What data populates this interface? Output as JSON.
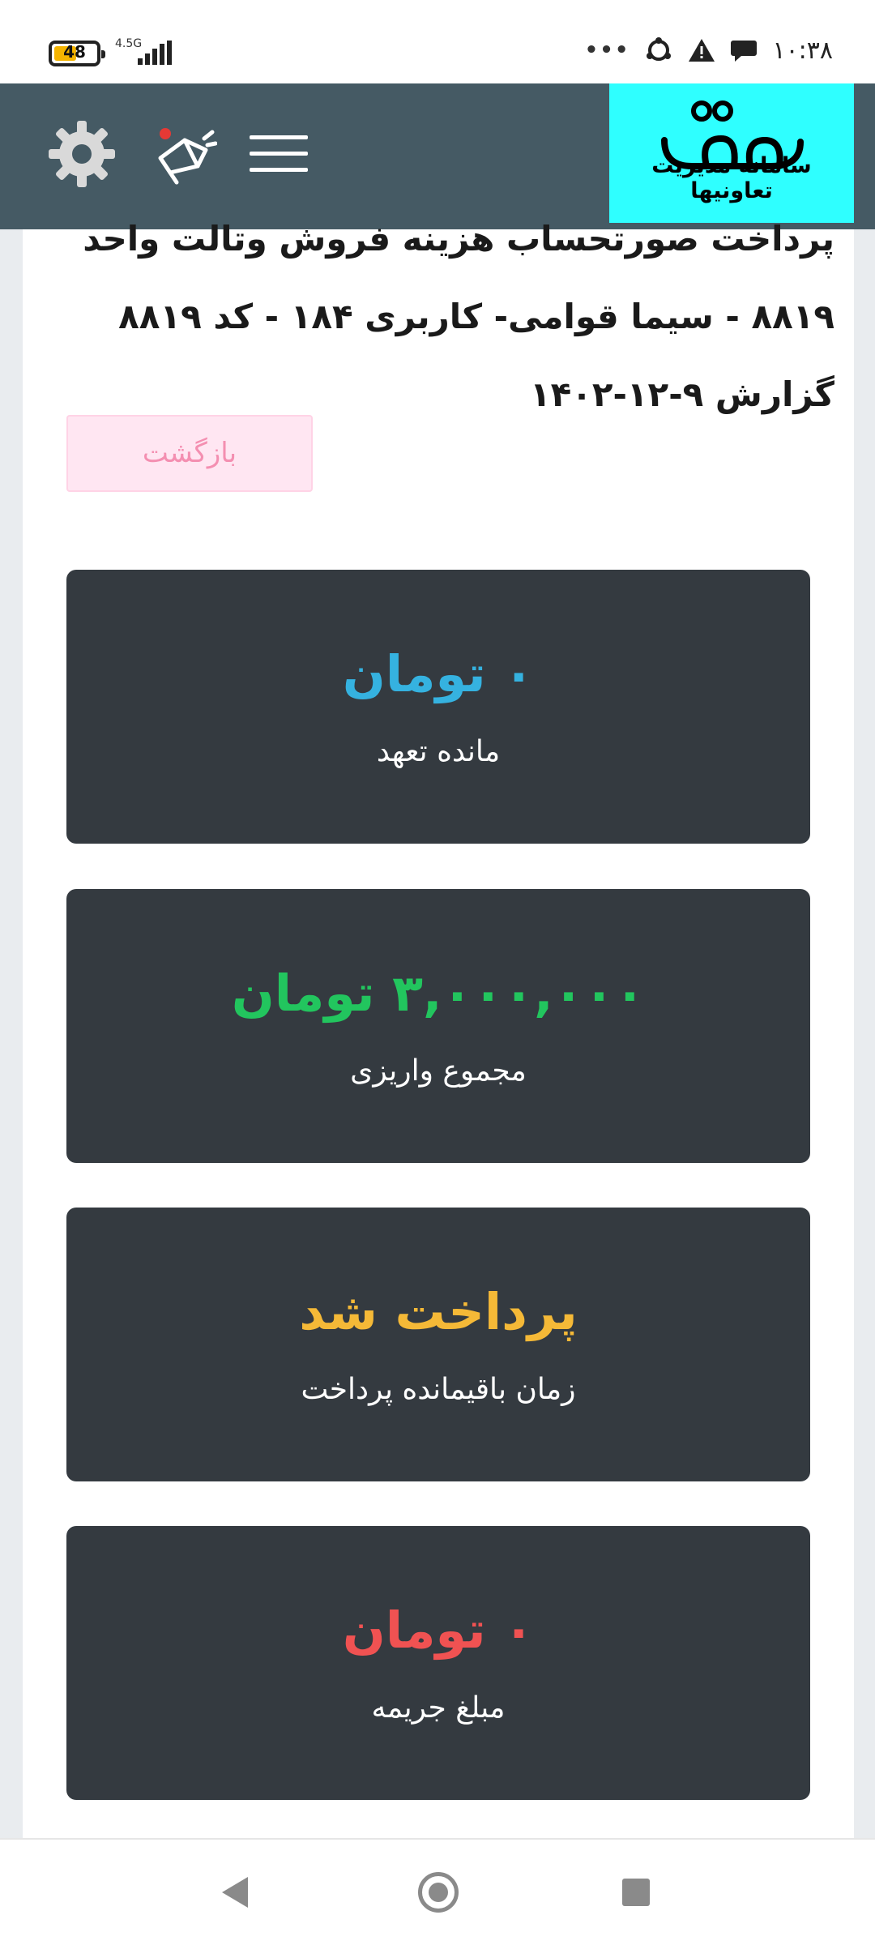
{
  "status_bar": {
    "battery_level": "48",
    "network": "4.5G",
    "time": "۱۰:۳۸",
    "icons": [
      "battery-icon",
      "signal-icon",
      "more-dots-icon",
      "sync-icon",
      "warning-icon",
      "chat-icon"
    ]
  },
  "header": {
    "logo_caption": "سامانه مدیریت تعاونیها",
    "icons": [
      "settings-gear-icon",
      "announcement-megaphone-icon",
      "menu-hamburger-icon"
    ],
    "colors": {
      "background": "#455a64",
      "logo_bg": "#2fffff"
    }
  },
  "page": {
    "title": "پرداخت صورتحساب هزینه فروش وتالت واحد ۸۸۱۹ - سیما قوامی- کاربری ۱۸۴ - کد ۸۸۱۹ گزارش ۹-۱۲-۱۴۰۲",
    "back_button": "بازگشت"
  },
  "cards": [
    {
      "value": "۰ تومان",
      "label": "مانده تعهد",
      "color": "#35b2e0"
    },
    {
      "value": "۳,۰۰۰,۰۰۰ تومان",
      "label": "مجموع واریزی",
      "color": "#22c55e"
    },
    {
      "value": "پرداخت شد",
      "label": "زمان باقیمانده پرداخت",
      "color": "#f5b937"
    },
    {
      "value": "۰ تومان",
      "label": "مبلغ جریمه",
      "color": "#f05252"
    }
  ],
  "nav_bar": {
    "icons": [
      "back-triangle-icon",
      "home-circle-icon",
      "recents-square-icon"
    ]
  }
}
